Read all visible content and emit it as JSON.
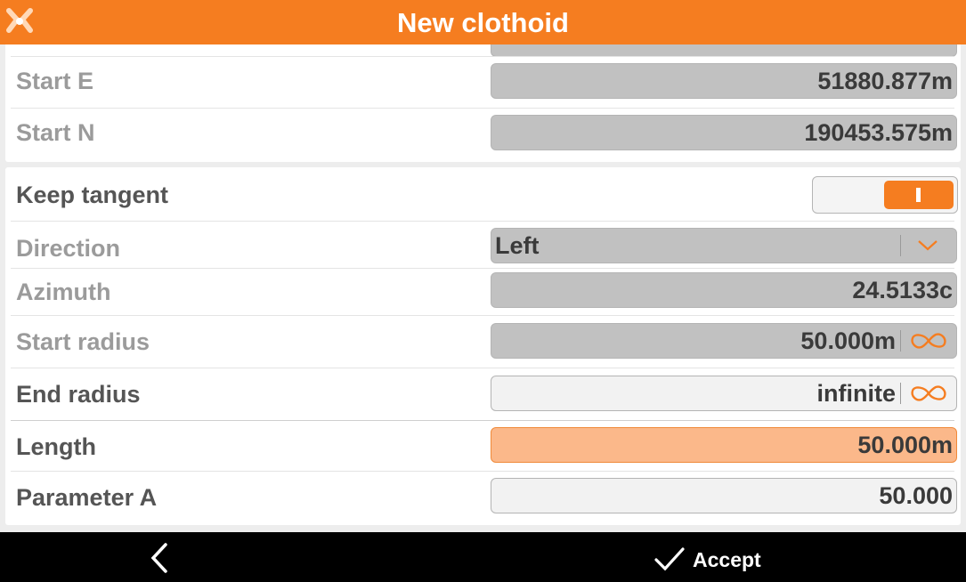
{
  "header": {
    "title": "New clothoid"
  },
  "start": {
    "e_label": "Start  E",
    "e_value": "51880.877m",
    "n_label": "Start  N",
    "n_value": "190453.575m"
  },
  "form": {
    "keep_tangent_label": "Keep tangent",
    "keep_tangent_on": true,
    "direction_label": "Direction",
    "direction_value": "Left",
    "azimuth_label": "Azimuth",
    "azimuth_value": "24.5133c",
    "start_radius_label": "Start radius",
    "start_radius_value": "50.000m",
    "end_radius_label": "End radius",
    "end_radius_value": "infinite",
    "length_label": "Length",
    "length_value": "50.000m",
    "parameter_a_label": "Parameter A",
    "parameter_a_value": "50.000"
  },
  "footer": {
    "accept_label": "Accept"
  },
  "colors": {
    "accent": "#f57d20",
    "highlight_field": "#fbb88a",
    "readonly_field": "#c1c1c1"
  },
  "icons": {
    "app": "app-logo-icon",
    "infinity": "infinity-icon",
    "dropdown": "chevron-down-icon",
    "back": "chevron-left-icon",
    "accept": "checkmark-icon"
  }
}
